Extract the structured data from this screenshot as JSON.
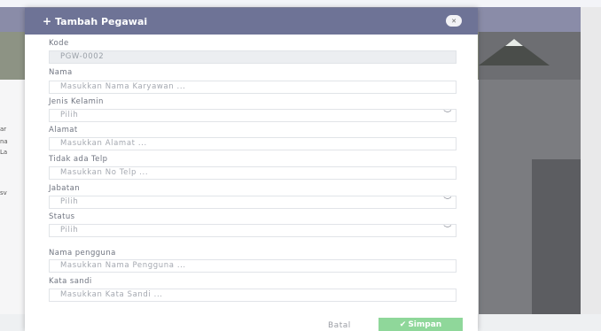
{
  "modal": {
    "title": "Tambah Pegawai",
    "icons": {
      "add": "plus-icon",
      "close": "close-icon",
      "select": "chevron-down-icon",
      "save": "check-icon"
    },
    "fields": {
      "kode": {
        "label": "Kode",
        "value": "PGW-0002"
      },
      "nama": {
        "label": "Nama",
        "placeholder": "Masukkan Nama Karyawan ..."
      },
      "jenis_kelamin": {
        "label": "Jenis Kelamin",
        "selected": "Pilih"
      },
      "alamat": {
        "label": "Alamat",
        "placeholder": "Masukkan Alamat ..."
      },
      "telp": {
        "label": "Tidak ada Telp",
        "placeholder": "Masukkan No Telp ..."
      },
      "jabatan": {
        "label": "Jabatan",
        "selected": "Pilih"
      },
      "status": {
        "label": "Status",
        "selected": "Pilih"
      },
      "nama_pengguna": {
        "label": "Nama pengguna",
        "placeholder": "Masukkan Nama Pengguna ..."
      },
      "kata_sandi": {
        "label": "Kata sandi",
        "placeholder": "Masukkan Kata Sandi ..."
      }
    },
    "buttons": {
      "cancel": "Batal",
      "save": "Simpan"
    }
  },
  "background": {
    "side_texts": [
      "ar",
      "na",
      "La",
      "sv"
    ]
  },
  "colors": {
    "header": "#6e7396",
    "save_button": "#8fd79a"
  }
}
